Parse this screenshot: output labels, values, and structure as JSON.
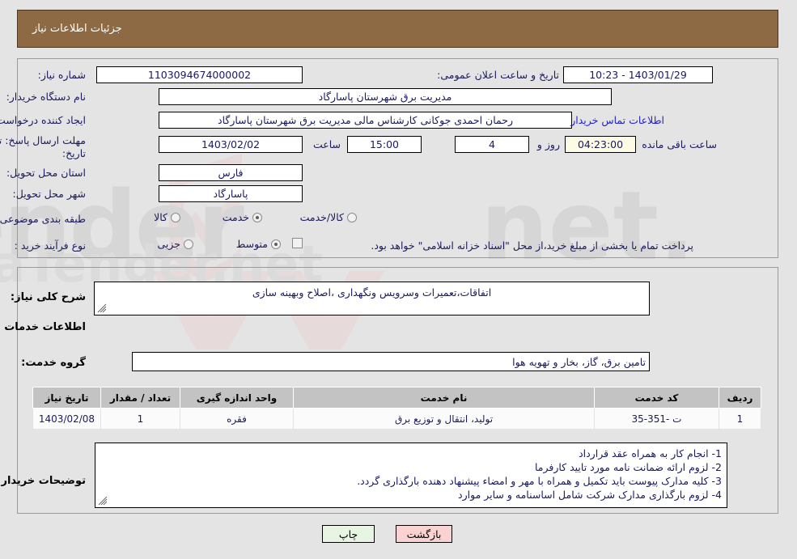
{
  "header": {
    "title": "جزئیات اطلاعات نیاز",
    "bar_color": "#8d6a43"
  },
  "top_section": {
    "need_number": {
      "label": "شماره نیاز:",
      "value": "1103094674000002"
    },
    "buyer_org": {
      "label": "نام دستگاه خریدار:",
      "value": "مدیریت برق شهرستان پاسارگاد"
    },
    "requester": {
      "label": "ایجاد کننده درخواست:",
      "value": "رحمان احمدی جوکانی کارشناس مالی مدیریت برق شهرستان پاسارگاد"
    },
    "buyer_contact_link": "اطلاعات تماس خریدار",
    "deadline": {
      "label_line1": "مهلت ارسال پاسخ: تا",
      "label_line2": "تاریخ:",
      "date": "1403/02/02",
      "hour_label": "ساعت",
      "hour": "15:00",
      "days": "4",
      "days_label": "روز و",
      "remaining": "04:23:00",
      "remaining_label": "ساعت باقی مانده"
    },
    "announce": {
      "label": "تاریخ و ساعت اعلان عمومی:",
      "value": "1403/01/29 - 10:23"
    },
    "province": {
      "label": "استان محل تحویل:",
      "value": "فارس"
    },
    "city": {
      "label": "شهر محل تحویل:",
      "value": "پاسارگاد"
    },
    "category": {
      "label": "طبقه بندی موضوعی:",
      "options": [
        "کالا",
        "خدمت",
        "کالا/خدمت"
      ],
      "selected": "خدمت"
    },
    "purchase_type": {
      "label": "نوع فرآیند خرید :",
      "options": [
        "جزیی",
        "متوسط"
      ],
      "selected": "متوسط"
    },
    "treasury_note": {
      "checked": false,
      "text": "پرداخت تمام یا بخشی از مبلغ خرید،از محل \"اسناد خزانه اسلامی\" خواهد بود."
    }
  },
  "bottom_section": {
    "general_desc": {
      "label": "شرح کلی نیاز:",
      "value": "اتفاقات،تعمیرات وسرویس ونگهداری ،اصلاح وبهینه سازی"
    },
    "services_heading": "اطلاعات خدمات مورد نیاز",
    "service_group": {
      "label": "گروه خدمت:",
      "value": "تامین برق، گاز، بخار و تهویه هوا"
    },
    "table": {
      "columns": [
        "ردیف",
        "کد خدمت",
        "نام خدمت",
        "واحد اندازه گیری",
        "تعداد / مقدار",
        "تاریخ نیاز"
      ],
      "rows": [
        {
          "row_no": "1",
          "service_code": "ت -351-35",
          "service_name": "تولید، انتقال و توزیع برق",
          "unit": "فقره",
          "quantity": "1",
          "need_date": "1403/02/08"
        }
      ]
    },
    "buyer_notes": {
      "label": "توضیحات خریدار:",
      "lines": [
        "1- انجام کار به همراه عقد قرارداد",
        "2- لزوم ارائه ضمانت نامه مورد تایید کارفرما",
        "3- کلیه مدارک پیوست باید تکمیل و همراه با مهر و امضاء پیشنهاد دهنده بارگذاری گردد.",
        "4- لزوم بارگذاری مدارک شرکت شامل اساسنامه و سایر موارد"
      ]
    }
  },
  "footer": {
    "print_button": "چاپ",
    "back_button": "بازگشت"
  },
  "watermark": {
    "text": "AriaTender.net"
  }
}
